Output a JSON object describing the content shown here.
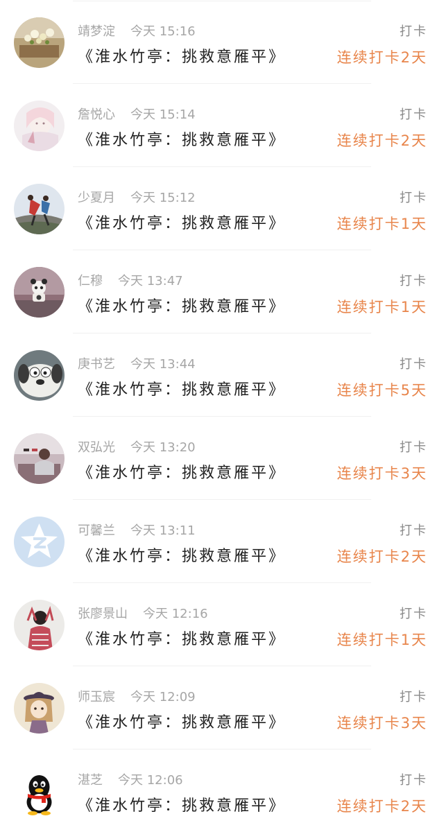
{
  "colors": {
    "streak_accent": "#e8854b",
    "meta_text": "#a6a6a6",
    "title_text": "#222222",
    "divider": "#f0f0f0"
  },
  "checkins": [
    {
      "user": "靖梦淀",
      "time": "今天 15:16",
      "title": "《淮水竹亭：挑救意雁平》",
      "checkin_label": "打卡",
      "streak": "连续打卡2天",
      "avatar_icon": "flower-photo-avatar"
    },
    {
      "user": "詹悦心",
      "time": "今天 15:14",
      "title": "《淮水竹亭：挑救意雁平》",
      "checkin_label": "打卡",
      "streak": "连续打卡2天",
      "avatar_icon": "anime-illustration-avatar"
    },
    {
      "user": "少夏月",
      "time": "今天 15:12",
      "title": "《淮水竹亭：挑救意雁平》",
      "checkin_label": "打卡",
      "streak": "连续打卡1天",
      "avatar_icon": "dancing-couple-avatar"
    },
    {
      "user": "仁穆",
      "time": "今天 13:47",
      "title": "《淮水竹亭：挑救意雁平》",
      "checkin_label": "打卡",
      "streak": "连续打卡1天",
      "avatar_icon": "panda-toy-avatar"
    },
    {
      "user": "庚书艺",
      "time": "今天 13:44",
      "title": "《淮水竹亭：挑救意雁平》",
      "checkin_label": "打卡",
      "streak": "连续打卡5天",
      "avatar_icon": "cartoon-dog-avatar"
    },
    {
      "user": "双弘光",
      "time": "今天 13:20",
      "title": "《淮水竹亭：挑救意雁平》",
      "checkin_label": "打卡",
      "streak": "连续打卡3天",
      "avatar_icon": "person-photo-avatar"
    },
    {
      "user": "可馨兰",
      "time": "今天 13:11",
      "title": "《淮水竹亭：挑救意雁平》",
      "checkin_label": "打卡",
      "streak": "连续打卡2天",
      "avatar_icon": "qzone-star-avatar"
    },
    {
      "user": "张廖景山",
      "time": "今天 12:16",
      "title": "《淮水竹亭：挑救意雁平》",
      "checkin_label": "打卡",
      "streak": "连续打卡1天",
      "avatar_icon": "girl-photo-avatar"
    },
    {
      "user": "师玉宸",
      "time": "今天 12:09",
      "title": "《淮水竹亭：挑救意雁平》",
      "checkin_label": "打卡",
      "streak": "连续打卡3天",
      "avatar_icon": "hat-girl-avatar"
    },
    {
      "user": "湛芝",
      "time": "今天 12:06",
      "title": "《淮水竹亭：挑救意雁平》",
      "checkin_label": "打卡",
      "streak": "连续打卡2天",
      "avatar_icon": "qq-penguin-avatar"
    }
  ]
}
